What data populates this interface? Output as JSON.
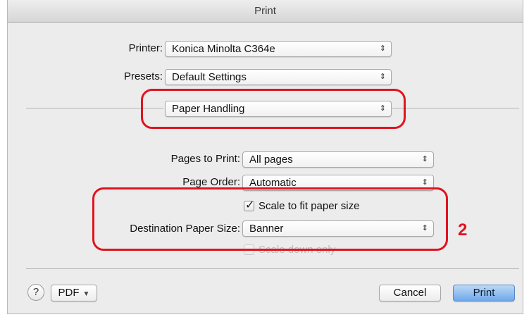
{
  "dialog": {
    "title": "Print"
  },
  "printer": {
    "label": "Printer:",
    "value": "Konica Minolta C364e"
  },
  "presets": {
    "label": "Presets:",
    "value": "Default Settings"
  },
  "section": {
    "value": "Paper Handling"
  },
  "pages_to_print": {
    "label": "Pages to Print:",
    "value": "All pages"
  },
  "page_order": {
    "label": "Page Order:",
    "value": "Automatic"
  },
  "scale_to_fit": {
    "label": "Scale to fit paper size",
    "checked": true
  },
  "destination_paper_size": {
    "label": "Destination Paper Size:",
    "value": "Banner"
  },
  "scale_down_only": {
    "label": "Scale down only",
    "checked": false,
    "enabled": false
  },
  "callout": {
    "number": "2",
    "color": "#e0141f"
  },
  "footer": {
    "help": "?",
    "pdf_label": "PDF",
    "cancel_label": "Cancel",
    "print_label": "Print"
  },
  "icons": {
    "popup_arrows": "⇕",
    "dropdown_caret": "▼",
    "checkmark": "✓"
  }
}
